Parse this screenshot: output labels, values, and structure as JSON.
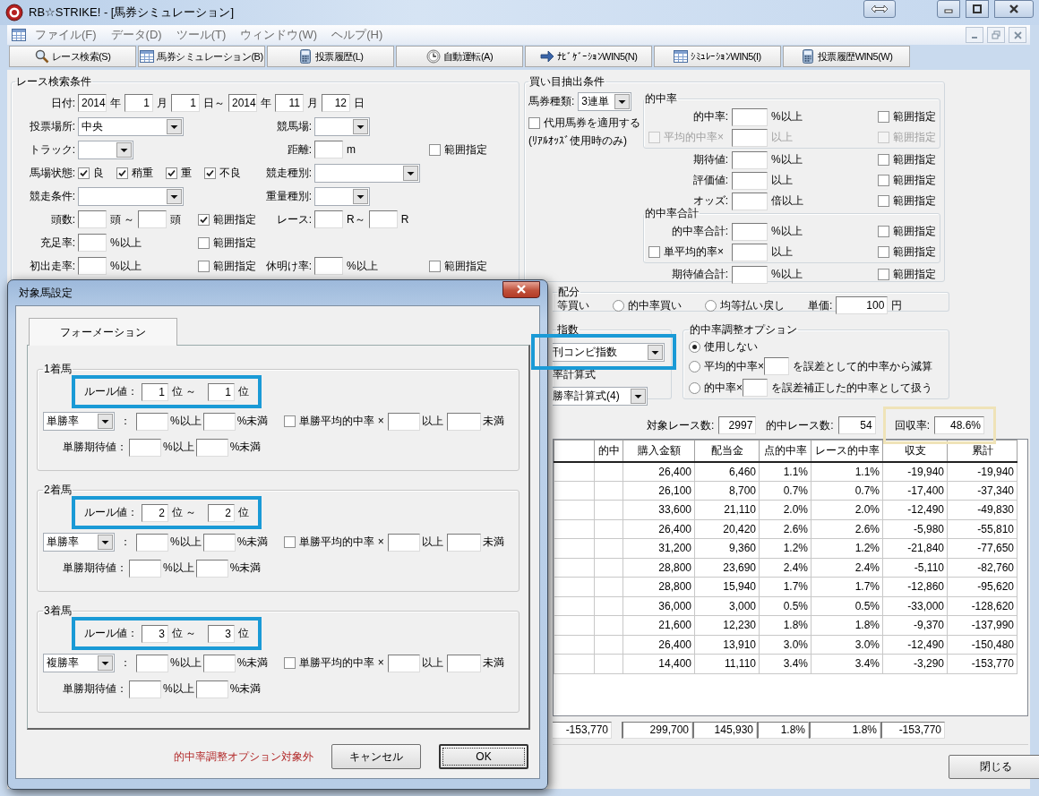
{
  "window": {
    "title": "RB☆STRIKE! - [馬券シミュレーション]"
  },
  "menu": [
    "ファイル(F)",
    "データ(D)",
    "ツール(T)",
    "ウィンドウ(W)",
    "ヘルプ(H)"
  ],
  "toolbar": [
    "レース検索(S)",
    "馬券シミュレーション(B)",
    "投票履歴(L)",
    "自動運転(A)",
    "ﾅﾋﾞｹﾞｰｼｮﾝWIN5(N)",
    "ｼﾐｭﾚｰｼｮﾝWIN5(I)",
    "投票履歴WIN5(W)"
  ],
  "race_search": {
    "title": "レース検索条件",
    "rows": [
      {
        "label": "日付:",
        "left": [
          {
            "kind": "field",
            "value": "2014"
          },
          {
            "kind": "text",
            "text": "年"
          },
          {
            "kind": "field",
            "value": "1"
          },
          {
            "kind": "text",
            "text": "月"
          },
          {
            "kind": "field",
            "value": "1"
          },
          {
            "kind": "text",
            "text": "日～"
          },
          {
            "kind": "field",
            "value": "2014"
          },
          {
            "kind": "text",
            "text": "年"
          },
          {
            "kind": "field",
            "value": "11"
          },
          {
            "kind": "text",
            "text": "月"
          },
          {
            "kind": "field",
            "value": "12"
          },
          {
            "kind": "text",
            "text": "日"
          }
        ]
      },
      {
        "label": "投票場所:",
        "left": [
          {
            "kind": "wide-combo",
            "value": "中央"
          }
        ],
        "mid_label": "競馬場:",
        "mid": [
          {
            "kind": "combo"
          }
        ]
      },
      {
        "label": "トラック:",
        "left": [
          {
            "kind": "combo"
          }
        ],
        "mid_label": "距離:",
        "mid": [
          {
            "kind": "field"
          },
          {
            "kind": "text",
            "text": "m"
          }
        ],
        "right": [
          {
            "kind": "check",
            "label": "範囲指定",
            "checked": false
          }
        ]
      },
      {
        "label": "馬場状態:",
        "left": [
          {
            "kind": "check",
            "label": "良",
            "checked": true
          },
          {
            "kind": "check",
            "label": "稍重",
            "checked": true
          },
          {
            "kind": "check",
            "label": "重",
            "checked": true
          },
          {
            "kind": "check",
            "label": "不良",
            "checked": true
          }
        ],
        "mid_label": "競走種別:",
        "mid": [
          {
            "kind": "wide-combo"
          }
        ]
      },
      {
        "label": "競走条件:",
        "left": [
          {
            "kind": "wide-combo"
          }
        ],
        "mid_label": "重量種別:",
        "mid": [
          {
            "kind": "combo"
          }
        ]
      },
      {
        "label": "頭数:",
        "left": [
          {
            "kind": "field"
          },
          {
            "kind": "text",
            "text": "頭 ～"
          },
          {
            "kind": "field"
          },
          {
            "kind": "text",
            "text": "頭"
          }
        ],
        "range": [
          {
            "kind": "check",
            "label": "範囲指定",
            "checked": true
          }
        ],
        "mid_label": "レース:",
        "mid": [
          {
            "kind": "field"
          },
          {
            "kind": "text",
            "text": "R～"
          },
          {
            "kind": "field"
          },
          {
            "kind": "text",
            "text": "R"
          }
        ]
      },
      {
        "label": "充足率:",
        "left": [
          {
            "kind": "field"
          },
          {
            "kind": "text",
            "text": "%以上"
          }
        ],
        "range": [
          {
            "kind": "check",
            "label": "範囲指定",
            "checked": false
          }
        ]
      },
      {
        "label": "初出走率:",
        "left": [
          {
            "kind": "field"
          },
          {
            "kind": "text",
            "text": "%以上"
          }
        ],
        "range": [
          {
            "kind": "check",
            "label": "範囲指定",
            "checked": false
          }
        ],
        "mid_label": "休明け率:",
        "mid": [
          {
            "kind": "field"
          },
          {
            "kind": "text",
            "text": "%以上"
          }
        ],
        "right": [
          {
            "kind": "check",
            "label": "範囲指定",
            "checked": false
          }
        ]
      }
    ]
  },
  "buy_conditions": {
    "title": "買い目抽出条件",
    "ticket_label": "馬券種類:",
    "ticket_type": "3連単",
    "substitute": {
      "label": "代用馬券を適用する",
      "checked": false
    },
    "note": "(ﾘｱﾙｵｯｽﾞ使用時のみ)",
    "sections": [
      {
        "title": "的中率",
        "rows": [
          {
            "kind": "field",
            "label": "的中率:",
            "unit": "%以上",
            "disabled": false,
            "range": {
              "label": "範囲指定",
              "checked": false
            }
          },
          {
            "kind": "check",
            "label": "平均的中率×",
            "checked": false,
            "unit": "以上",
            "disabled": true,
            "range": {
              "label": "範囲指定",
              "checked": false
            }
          }
        ]
      },
      {
        "rows": [
          {
            "kind": "field",
            "label": "期待値:",
            "unit": "%以上",
            "disabled": false,
            "range": {
              "label": "範囲指定",
              "checked": false
            }
          },
          {
            "kind": "field",
            "label": "評価値:",
            "unit": "以上",
            "disabled": false,
            "range": {
              "label": "範囲指定",
              "checked": false
            }
          },
          {
            "kind": "field",
            "label": "オッズ:",
            "unit": "倍以上",
            "disabled": false,
            "range": {
              "label": "範囲指定",
              "checked": false
            }
          }
        ]
      },
      {
        "title": "的中率合計",
        "rows": [
          {
            "kind": "field",
            "label": "的中率合計:",
            "unit": "%以上",
            "disabled": false,
            "range": {
              "label": "範囲指定",
              "checked": false
            }
          },
          {
            "kind": "check",
            "label": "単平均的率×",
            "checked": false,
            "unit": "以上",
            "disabled": false,
            "range": {
              "label": "範囲指定",
              "checked": false
            }
          }
        ]
      },
      {
        "rows": [
          {
            "kind": "field",
            "label": "期待値合計:",
            "unit": "%以上",
            "disabled": false,
            "range": {
              "label": "範囲指定",
              "checked": false
            }
          }
        ]
      }
    ]
  },
  "allocation": {
    "title": "配分",
    "cut_option": "等買い",
    "options": [
      {
        "label": "的中率買い",
        "selected": false
      },
      {
        "label": "均等払い戻し",
        "selected": false
      }
    ],
    "unit_price_label": "単価:",
    "unit_price": "100",
    "currency": "円"
  },
  "index": {
    "title": "指数",
    "index_type": "刊コンビ指数",
    "highlighted": true,
    "formula_label": "率計算式",
    "formula": "勝率計算式(4)"
  },
  "adjust": {
    "title": "的中率調整オプション",
    "options": [
      {
        "kind": "plain",
        "label": "使用しない",
        "selected": true
      },
      {
        "kind": "field",
        "label": "平均的中率×",
        "after": "を誤差として的中率から減算",
        "selected": false
      },
      {
        "kind": "field",
        "label": "的中率×",
        "after": "を誤差補正した的中率として扱う",
        "selected": false
      }
    ]
  },
  "stats": [
    {
      "label": "対象レース数:",
      "value": "2997",
      "highlighted": false
    },
    {
      "label": "的中レース数:",
      "value": "54",
      "highlighted": false
    },
    {
      "label": "回収率:",
      "value": "48.6%",
      "highlighted": true
    }
  ],
  "table": {
    "columns": [
      "",
      "的中",
      "購入金額",
      "配当金",
      "点的中率",
      "レース的中率",
      "収支",
      "累計"
    ],
    "rows": [
      [
        "",
        "",
        "26,400",
        "6,460",
        "1.1%",
        "1.1%",
        "-19,940",
        "-19,940"
      ],
      [
        "",
        "",
        "26,100",
        "8,700",
        "0.7%",
        "0.7%",
        "-17,400",
        "-37,340"
      ],
      [
        "",
        "",
        "33,600",
        "21,110",
        "2.0%",
        "2.0%",
        "-12,490",
        "-49,830"
      ],
      [
        "",
        "",
        "26,400",
        "20,420",
        "2.6%",
        "2.6%",
        "-5,980",
        "-55,810"
      ],
      [
        "",
        "",
        "31,200",
        "9,360",
        "1.2%",
        "1.2%",
        "-21,840",
        "-77,650"
      ],
      [
        "",
        "",
        "28,800",
        "23,690",
        "2.4%",
        "2.4%",
        "-5,110",
        "-82,760"
      ],
      [
        "",
        "",
        "28,800",
        "15,940",
        "1.7%",
        "1.7%",
        "-12,860",
        "-95,620"
      ],
      [
        "",
        "",
        "36,000",
        "3,000",
        "0.5%",
        "0.5%",
        "-33,000",
        "-128,620"
      ],
      [
        "",
        "",
        "21,600",
        "12,230",
        "1.8%",
        "1.8%",
        "-9,370",
        "-137,990"
      ],
      [
        "",
        "",
        "26,400",
        "13,910",
        "3.0%",
        "3.0%",
        "-12,490",
        "-150,480"
      ],
      [
        "",
        "",
        "14,400",
        "11,110",
        "3.4%",
        "3.4%",
        "-3,290",
        "-153,770"
      ]
    ]
  },
  "totals": [
    "-153,770",
    "299,700",
    "145,930",
    "1.8%",
    "1.8%",
    "-153,770"
  ],
  "close_button": "閉じる",
  "dialog": {
    "title": "対象馬設定",
    "tabs": [
      {
        "label": "フォーメーション",
        "selected": true
      }
    ],
    "groups": [
      {
        "title": "1着馬",
        "highlighted": true,
        "rule_label": "ルール値：",
        "rule_from": "1",
        "from_unit": "位 ～",
        "rule_to": "1",
        "to_unit": "位",
        "rate_type": "単勝率",
        "colon": "：",
        "min_unit": "%以上",
        "max_unit": "%未満",
        "avg": {
          "label": "単勝平均的中率 ×",
          "checked": false
        },
        "avg_min_unit": "以上",
        "avg_max_unit": "未満",
        "expect_label": "単勝期待値：",
        "expect_min_unit": "%以上",
        "expect_max_unit": "%未満"
      },
      {
        "title": "2着馬",
        "highlighted": true,
        "rule_label": "ルール値：",
        "rule_from": "2",
        "from_unit": "位 ～",
        "rule_to": "2",
        "to_unit": "位",
        "rate_type": "単勝率",
        "colon": "：",
        "min_unit": "%以上",
        "max_unit": "%未満",
        "avg": {
          "label": "単勝平均的中率 ×",
          "checked": false
        },
        "avg_min_unit": "以上",
        "avg_max_unit": "未満",
        "expect_label": "単勝期待値：",
        "expect_min_unit": "%以上",
        "expect_max_unit": "%未満"
      },
      {
        "title": "3着馬",
        "highlighted": true,
        "rule_label": "ルール値：",
        "rule_from": "3",
        "from_unit": "位 ～",
        "rule_to": "3",
        "to_unit": "位",
        "rate_type": "複勝率",
        "colon": "：",
        "min_unit": "%以上",
        "max_unit": "%未満",
        "avg": {
          "label": "単勝平均的中率 ×",
          "checked": false
        },
        "avg_min_unit": "以上",
        "avg_max_unit": "未満",
        "expect_label": "単勝期待値：",
        "expect_min_unit": "%以上",
        "expect_max_unit": "%未満"
      }
    ],
    "note": "的中率調整オプション対象外",
    "buttons": [
      {
        "label": "キャンセル",
        "default": false
      },
      {
        "label": "OK",
        "default": true
      }
    ]
  }
}
